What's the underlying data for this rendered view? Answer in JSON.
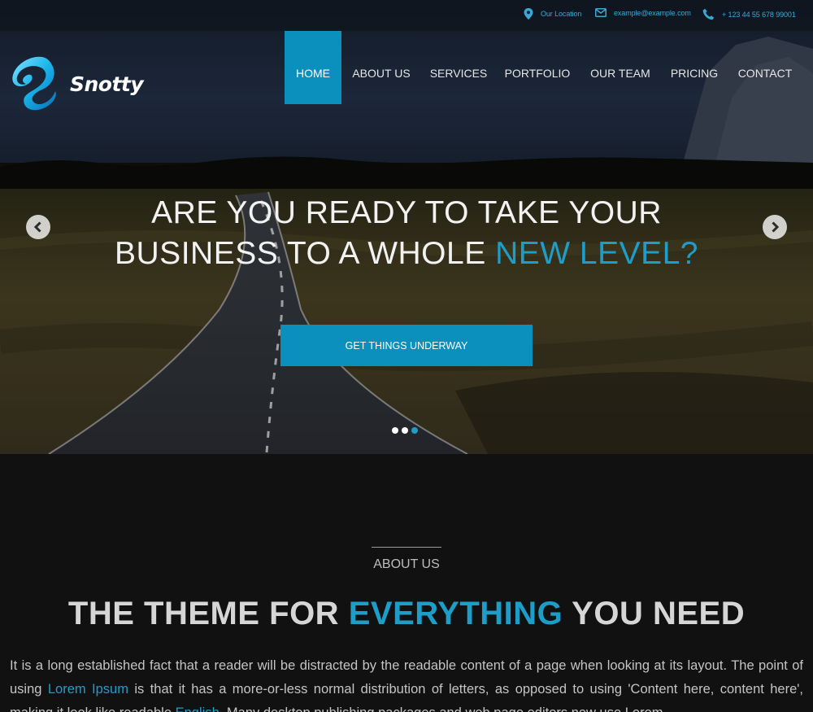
{
  "topbar": {
    "location": {
      "icon": "map-pin-icon",
      "text": "Our Location"
    },
    "email": {
      "icon": "envelope-icon",
      "text": "example@example.com"
    },
    "phone": {
      "icon": "phone-icon",
      "text": "+ 123 44 55 678 99001"
    }
  },
  "brand": {
    "name": "Snotty",
    "logo": "swirl-logo"
  },
  "nav": {
    "items": [
      {
        "label": "HOME",
        "active": true
      },
      {
        "label": "ABOUT US"
      },
      {
        "label": "SERVICES"
      },
      {
        "label": "PORTFOLIO"
      },
      {
        "label": "OUR TEAM"
      },
      {
        "label": "PRICING"
      },
      {
        "label": "CONTACT"
      }
    ]
  },
  "hero": {
    "line1": "ARE YOU READY TO TAKE YOUR",
    "line2_prefix": "BUSINESS TO A WHOLE",
    "line2_accent": "NEW LEVEL?",
    "cta_label": "GET THINGS UNDERWAY",
    "prev_icon": "chevron-left-icon",
    "next_icon": "chevron-right-icon",
    "slide_count": 3,
    "active_slide": 3
  },
  "about": {
    "label": "ABOUT US",
    "title_prefix": "THE THEME FOR",
    "title_accent": "EVERYTHING",
    "title_suffix": "YOU NEED",
    "body_1": "It is a long established fact that a reader will be distracted by the readable content of a page when looking at its layout. The point of using",
    "body_link_1": "Lorem Ipsum",
    "body_2": "is that it has a more-or-less normal distribution of letters, as opposed to using 'Content here, content here', making it look like readable",
    "body_link_2": "English",
    "body_3": ". Many desktop publishing packages and web page editors now use Lorem"
  },
  "colors": {
    "accent": "#0b8fbd",
    "accent_text": "#1d9ec9",
    "page_background": "#111112"
  }
}
